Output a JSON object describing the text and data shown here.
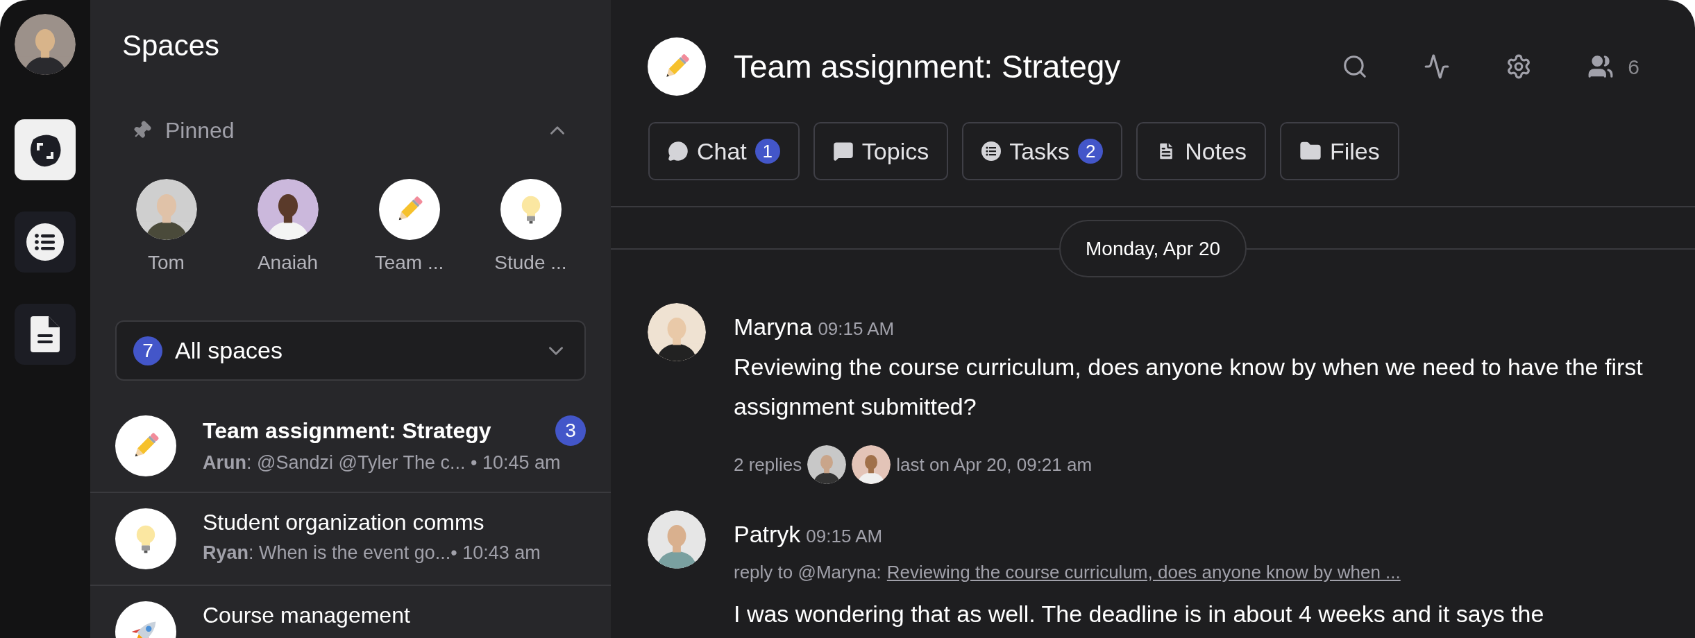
{
  "rail": {
    "items": [
      {
        "kind": "scan",
        "selected": true
      },
      {
        "kind": "list",
        "selected": false
      },
      {
        "kind": "document",
        "selected": false
      }
    ]
  },
  "sidebar": {
    "title": "Spaces",
    "pinned": {
      "label": "Pinned",
      "expanded": true,
      "items": [
        {
          "label": "Tom",
          "kind": "picture"
        },
        {
          "label": "Anaiah",
          "kind": "picture"
        },
        {
          "label": "Team ...",
          "kind": "pencil"
        },
        {
          "label": "Stude ...",
          "kind": "bulb"
        }
      ]
    },
    "filter": {
      "count": "7",
      "label": "All spaces"
    },
    "spaces": [
      {
        "kind": "pencil",
        "title": "Team assignment: Strategy",
        "unread": true,
        "author": "Arun",
        "preview": ": @Sandzi @Tyler The c...",
        "time": " • 10:45 am",
        "badge": "3"
      },
      {
        "kind": "bulb",
        "title": "Student organization comms",
        "unread": false,
        "author": "Ryan",
        "preview": ": When is the event go...",
        "time": "• 10:43 am"
      },
      {
        "kind": "rocket",
        "title": "Course management",
        "unread": false
      }
    ]
  },
  "space": {
    "title": "Team assignment: Strategy",
    "kind": "pencil",
    "members": "6",
    "tabs": [
      {
        "kind": "chat",
        "label": "Chat",
        "badge": "1"
      },
      {
        "kind": "topics",
        "label": "Topics"
      },
      {
        "kind": "tasks",
        "label": "Tasks",
        "badge": "2"
      },
      {
        "kind": "notes",
        "label": "Notes"
      },
      {
        "kind": "files",
        "label": "Files"
      }
    ]
  },
  "date": "Monday, Apr 20",
  "messages": [
    {
      "author": "Maryna",
      "time": "09:15 AM",
      "text": "Reviewing the course curriculum, does anyone know by when we need to have the first assignment submitted?",
      "replies": {
        "count": "2 replies",
        "last": "last on Apr 20, 09:21 am"
      }
    },
    {
      "author": "Patryk",
      "time": "09:15 AM",
      "reply_to": {
        "label": "reply to @Maryna:",
        "quote": "Reviewing the course curriculum, does anyone know by when ..."
      },
      "text": "I was wondering that as well. The deadline is in about 4 weeks and it says the"
    }
  ]
}
